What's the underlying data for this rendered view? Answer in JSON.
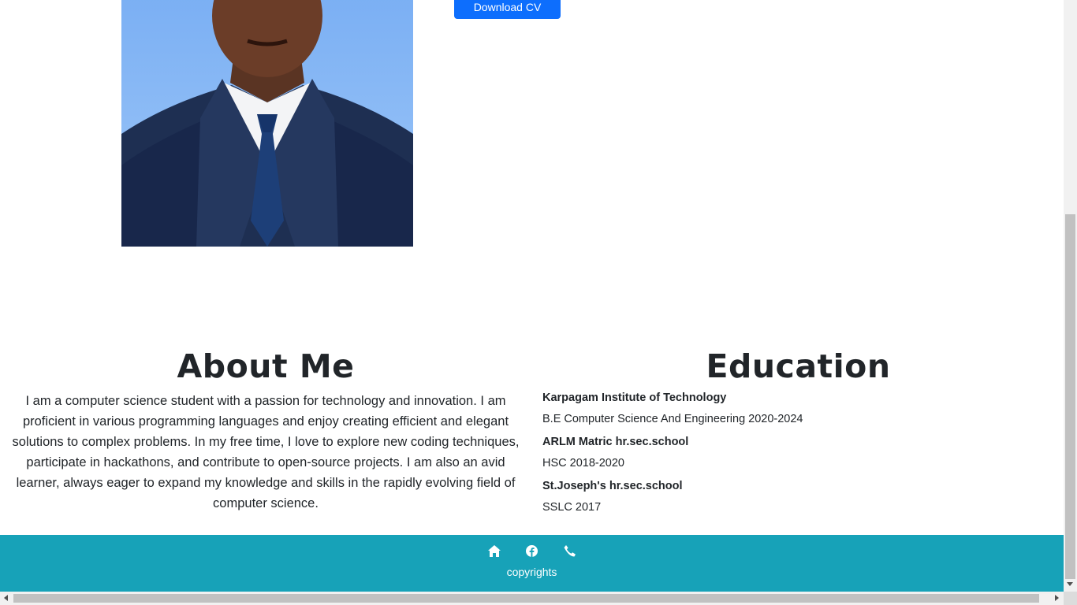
{
  "hero": {
    "download_label": "Download CV"
  },
  "about": {
    "title": "About Me",
    "text": "I am a computer science student with a passion for technology and innovation. I am proficient in various programming languages and enjoy creating efficient and elegant solutions to complex problems. In my free time, I love to explore new coding techniques, participate in hackathons, and contribute to open-source projects. I am also an avid learner, always eager to expand my knowledge and skills in the rapidly evolving field of computer science."
  },
  "education": {
    "title": "Education",
    "items": [
      {
        "school": "Karpagam Institute of Technology",
        "detail": "B.E Computer Science And Engineering 2020-2024"
      },
      {
        "school": "ARLM Matric hr.sec.school",
        "detail": "HSC 2018-2020"
      },
      {
        "school": "St.Joseph's hr.sec.school",
        "detail": "SSLC 2017"
      }
    ]
  },
  "footer": {
    "icons": [
      "home-icon",
      "facebook-icon",
      "phone-icon"
    ],
    "copyright": "copyrights",
    "background": "#17a2b8"
  },
  "colors": {
    "button": "#0d6efd",
    "text": "#212529"
  }
}
